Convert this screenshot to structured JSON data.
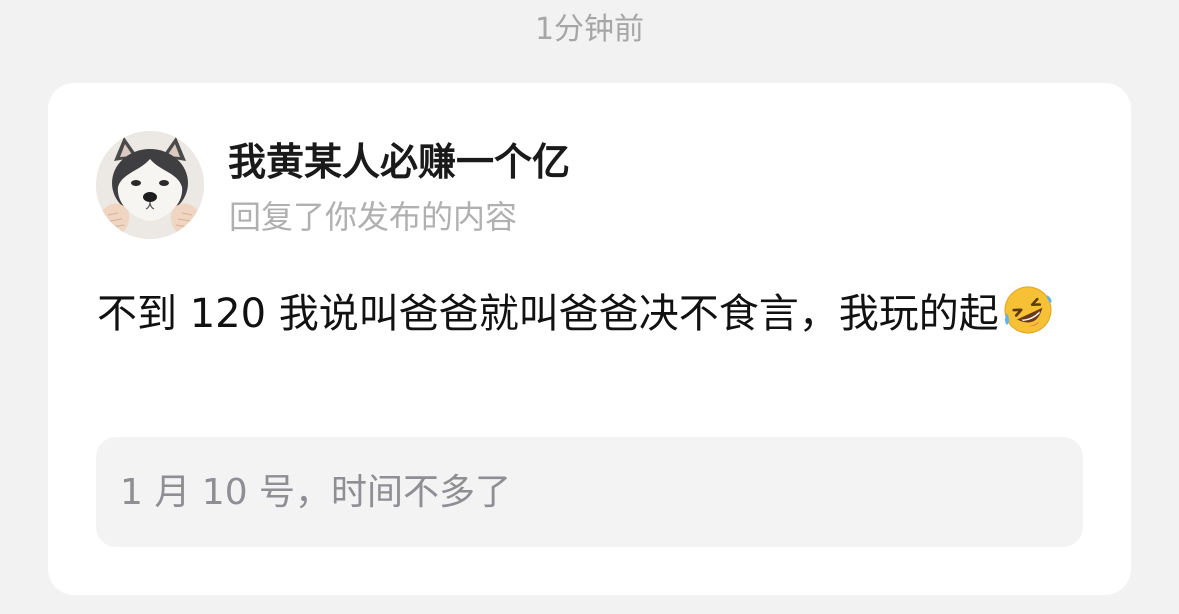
{
  "timestamp": "1分钟前",
  "notification": {
    "username": "我黄某人必赚一个亿",
    "subtitle": "回复了你发布的内容",
    "avatar_icon": "husky-dog-avatar",
    "content": "不到 120 我说叫爸爸就叫爸爸决不食言，我玩的起",
    "emoji_icon": "rolling-on-floor-laughing-emoji",
    "quote": "1 月 10 号，时间不多了"
  }
}
